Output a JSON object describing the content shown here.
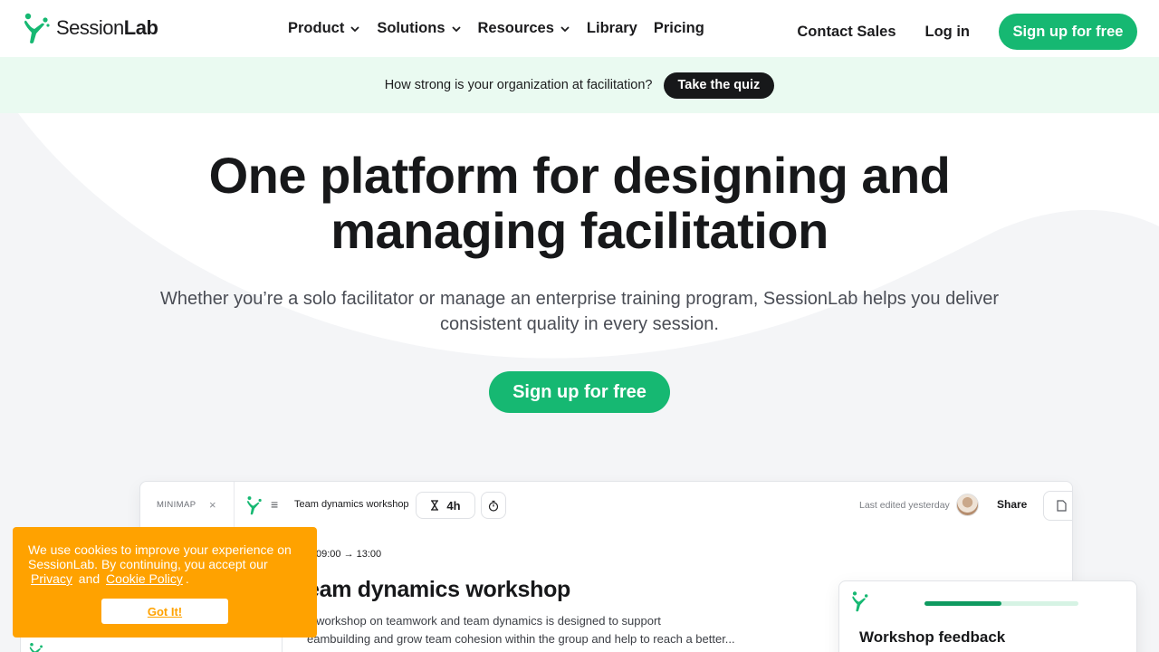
{
  "colors": {
    "brand_green": "#16b872",
    "banner_bg": "#eafaf1",
    "cookie_orange": "#ffa200",
    "dark": "#17181a"
  },
  "header": {
    "logo_prefix": "Session",
    "logo_suffix": "Lab",
    "nav": [
      {
        "label": "Product",
        "has_dropdown": true
      },
      {
        "label": "Solutions",
        "has_dropdown": true
      },
      {
        "label": "Resources",
        "has_dropdown": true
      },
      {
        "label": "Library",
        "has_dropdown": false
      },
      {
        "label": "Pricing",
        "has_dropdown": false
      }
    ],
    "contact_sales": "Contact Sales",
    "login": "Log in",
    "signup": "Sign up for free"
  },
  "banner": {
    "text": "How strong is your organization at facilitation?",
    "button": "Take the quiz"
  },
  "hero": {
    "title_line1": "One platform for designing and",
    "title_line2": "managing facilitation",
    "subtitle": "Whether you’re a solo facilitator or manage an enterprise training program, SessionLab helps you deliver consistent quality in every session.",
    "cta": "Sign up for free"
  },
  "mockup": {
    "minimap_label": "MINIMAP",
    "minimap_close": "×",
    "menu_glyph": "≡",
    "workshop_name": "Team dynamics workshop",
    "duration": "4h",
    "last_edited": "Last edited yesterday",
    "share": "Share",
    "time_range": "09:00 → 13:00",
    "session_title": "eam dynamics workshop",
    "session_desc_line1": "s workshop on teamwork and team dynamics is designed to  support",
    "session_desc_line2": "eambuilding and grow team cohesion within the group and help to reach a better..."
  },
  "feedback_card": {
    "title": "Workshop feedback",
    "progress": 0.5
  },
  "cookie": {
    "text": "We use cookies to improve your experience on SessionLab. By continuing, you accept our",
    "privacy": "Privacy",
    "and": "and",
    "cookie_policy": "Cookie Policy",
    "period": ".",
    "button": "Got It!"
  }
}
